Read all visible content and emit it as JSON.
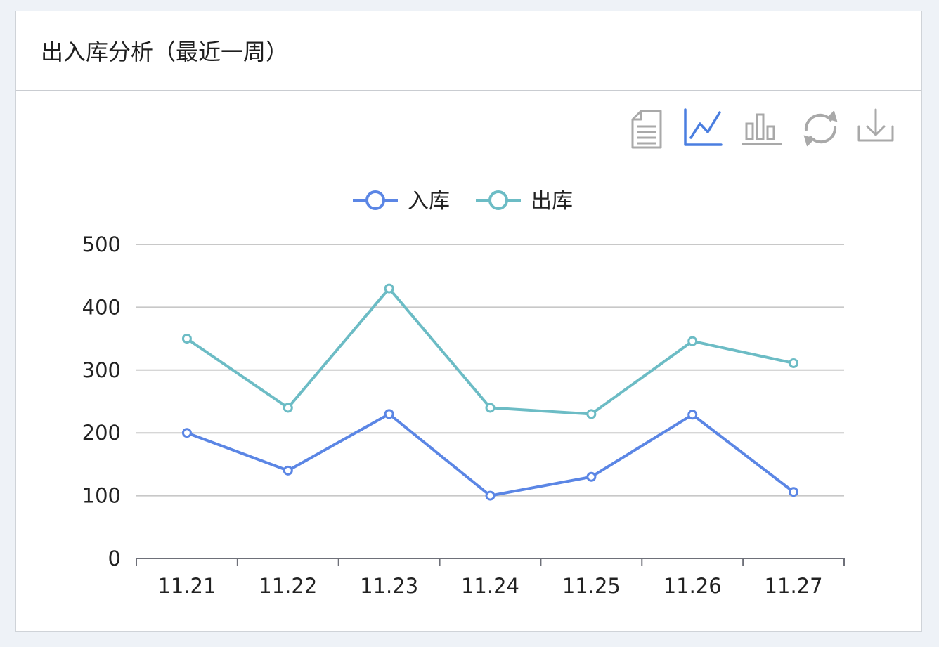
{
  "panel": {
    "title": "出入库分析（最近一周）"
  },
  "toolbox": [
    {
      "name": "data-view",
      "icon": "document-icon"
    },
    {
      "name": "line",
      "icon": "line-chart-icon",
      "active": true
    },
    {
      "name": "bar",
      "icon": "bar-chart-icon"
    },
    {
      "name": "restore",
      "icon": "refresh-icon"
    },
    {
      "name": "save-image",
      "icon": "download-icon"
    }
  ],
  "colors": {
    "inbound": "#5b86e5",
    "outbound": "#6cbcc5",
    "axis": "#6e7079",
    "grid": "#c8c8c8",
    "tool_inactive": "#a9a9a9",
    "tool_active": "#4a7ee0"
  },
  "chart_data": {
    "type": "line",
    "categories": [
      "11.21",
      "11.22",
      "11.23",
      "11.24",
      "11.25",
      "11.26",
      "11.27"
    ],
    "series": [
      {
        "name": "入库",
        "color": "#5b86e5",
        "values": [
          200,
          140,
          230,
          100,
          130,
          229,
          106
        ]
      },
      {
        "name": "出库",
        "color": "#6cbcc5",
        "values": [
          350,
          240,
          430,
          240,
          230,
          346,
          311
        ]
      }
    ],
    "yticks": [
      "0",
      "100",
      "200",
      "300",
      "400",
      "500"
    ],
    "ylim": [
      0,
      500
    ],
    "grid": true,
    "legend": "top-center"
  }
}
